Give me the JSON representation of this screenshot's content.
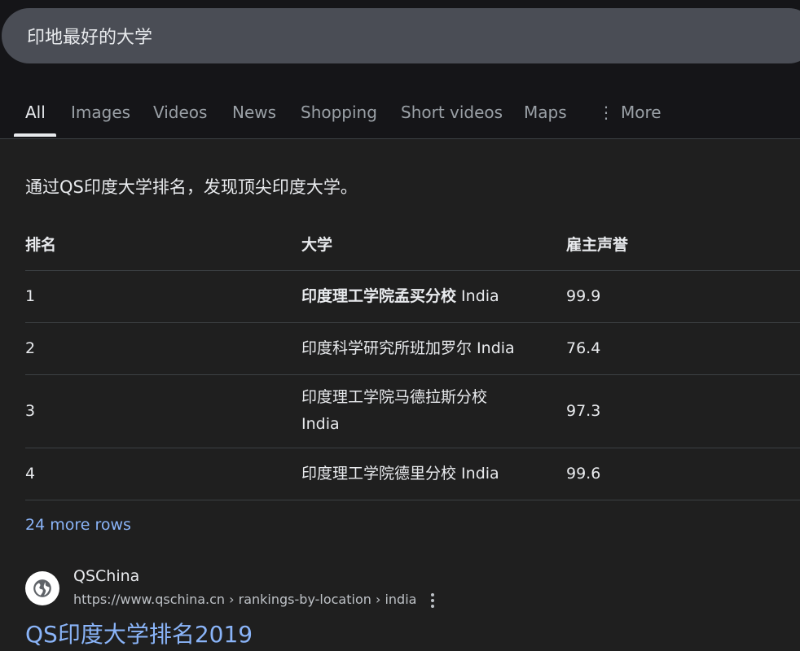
{
  "search": {
    "query": "印地最好的大学"
  },
  "tabs": [
    {
      "label": "All"
    },
    {
      "label": "Images"
    },
    {
      "label": "Videos"
    },
    {
      "label": "News"
    },
    {
      "label": "Shopping"
    },
    {
      "label": "Short videos"
    },
    {
      "label": "Maps"
    },
    {
      "label": "More"
    }
  ],
  "snippet": {
    "intro": "通过QS印度大学排名，发现顶尖印度大学。",
    "headers": [
      "排名",
      "大学",
      "雇主声誉"
    ],
    "rows": [
      {
        "rank": "1",
        "university": "印度理工学院孟买分校",
        "country": " India",
        "score": "99.9"
      },
      {
        "rank": "2",
        "university": "印度科学研究所班加罗尔",
        "country": " India",
        "score": "76.4"
      },
      {
        "rank": "3",
        "university": "印度理工学院马德拉斯分校",
        "country": " India",
        "score": "97.3"
      },
      {
        "rank": "4",
        "university": "印度理工学院德里分校",
        "country": " India",
        "score": "99.6"
      }
    ],
    "more_rows": "24 more rows"
  },
  "result": {
    "site_name": "QSChina",
    "url": "https://www.qschina.cn › rankings-by-location › india",
    "title": "QS印度大学排名2019"
  }
}
